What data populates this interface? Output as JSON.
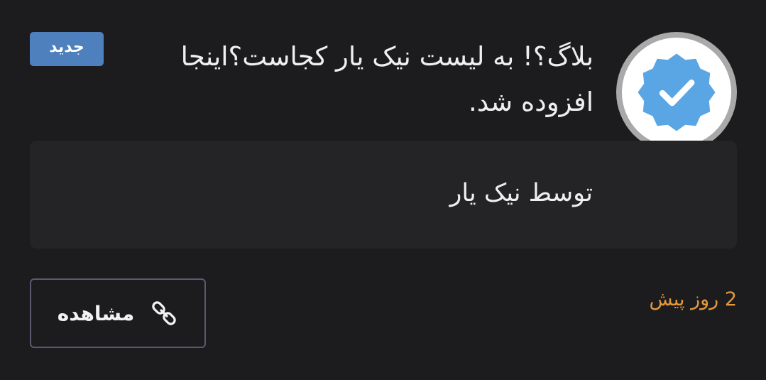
{
  "post": {
    "title": "بلاگ؟! به لیست نیک یار کجاست؟اینجا افزوده شد.",
    "badge_label": "جدید",
    "author_line": "توسط نیک یار",
    "view_button_label": "مشاهده",
    "time_ago": "2 روز پیش"
  },
  "icons": {
    "avatar": "verified-badge-icon",
    "view": "link-icon"
  },
  "colors": {
    "background": "#1c1c1e",
    "card": "#242426",
    "badge": "#4f80be",
    "verified_blue": "#5aa5e4",
    "time_text": "#e3983c",
    "button_border": "#5d5870"
  }
}
